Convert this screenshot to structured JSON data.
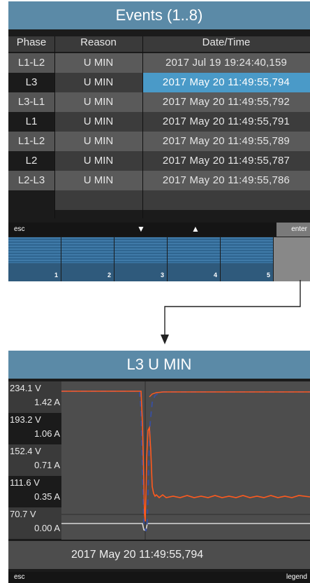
{
  "events": {
    "title": "Events (1..8)",
    "columns": [
      "Phase",
      "Reason",
      "Date/Time"
    ],
    "rows": [
      {
        "phase": "L1-L2",
        "reason": "U MIN",
        "datetime": "2017 Jul 19 19:24:40,159"
      },
      {
        "phase": "L3",
        "reason": "U MIN",
        "datetime": "2017 May 20 11:49:55,794",
        "selected": true
      },
      {
        "phase": "L3-L1",
        "reason": "U MIN",
        "datetime": "2017 May 20 11:49:55,792"
      },
      {
        "phase": "L1",
        "reason": "U MIN",
        "datetime": "2017 May 20 11:49:55,791"
      },
      {
        "phase": "L1-L2",
        "reason": "U MIN",
        "datetime": "2017 May 20 11:49:55,789"
      },
      {
        "phase": "L2",
        "reason": "U MIN",
        "datetime": "2017 May 20 11:49:55,787"
      },
      {
        "phase": "L2-L3",
        "reason": "U MIN",
        "datetime": "2017 May 20 11:49:55,786"
      },
      {
        "phase": "",
        "reason": "",
        "datetime": ""
      }
    ],
    "softkeys": {
      "esc": "esc",
      "enter": "enter",
      "down_icon": "triangle-down-icon",
      "up_icon": "triangle-up-icon"
    },
    "function_keys": [
      "1",
      "2",
      "3",
      "4",
      "5"
    ]
  },
  "waveform": {
    "title": "L3 U MIN",
    "axis_labels": [
      {
        "voltage": "234.1 V",
        "current": "1.42 A"
      },
      {
        "voltage": "193.2 V",
        "current": "1.06 A"
      },
      {
        "voltage": "152.4 V",
        "current": "0.71 A"
      },
      {
        "voltage": "111.6 V",
        "current": "0.35 A"
      },
      {
        "voltage": "70.7 V",
        "current": "0.00 A"
      }
    ],
    "timestamp": "2017 May 20 11:49:55,794",
    "softkeys": {
      "esc": "esc",
      "legend": "legend"
    },
    "colors": {
      "voltage_trace": "#ff5a1e",
      "dashed_trace": "#3a4f9a",
      "current_trace": "#d8d8d8",
      "accent": "#5b8aa7",
      "selection": "#4a9ac8"
    }
  }
}
